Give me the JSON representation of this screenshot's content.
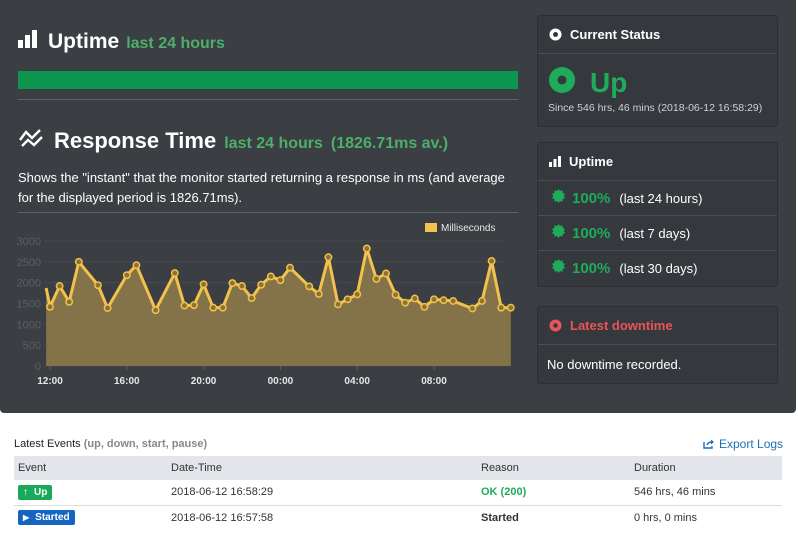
{
  "uptime_section": {
    "title": "Uptime",
    "subtitle": "last 24 hours",
    "bar_up_fraction": 1.0,
    "bar_color": "#0c9650"
  },
  "response_section": {
    "title": "Response Time",
    "subtitle": "last 24 hours",
    "average": "(1826.71ms av.)",
    "description": "Shows the \"instant\" that the monitor started returning a response in ms (and average for the displayed period is 1826.71ms)."
  },
  "chart_data": {
    "type": "area",
    "title": "",
    "legend": [
      "Milliseconds"
    ],
    "legend_position": "top-right",
    "xlabel": "",
    "ylabel": "",
    "ylim": [
      0,
      3000
    ],
    "yticks": [
      "0",
      "500",
      "1000",
      "1500",
      "2000",
      "2500",
      "3000"
    ],
    "xticks": [
      "12:00",
      "16:00",
      "20:00",
      "00:00",
      "04:00",
      "08:00"
    ],
    "x_hours": [
      -0.2,
      0.0,
      0.5,
      1.0,
      1.5,
      2.5,
      3.0,
      4.0,
      4.5,
      5.5,
      6.5,
      7.0,
      7.5,
      8.0,
      8.5,
      9.0,
      9.5,
      10.0,
      10.5,
      11.0,
      11.5,
      12.0,
      12.5,
      13.5,
      14.0,
      14.5,
      15.0,
      15.5,
      16.0,
      16.5,
      17.0,
      17.5,
      18.0,
      18.5,
      19.0,
      19.5,
      20.0,
      20.5,
      21.0,
      22.0,
      22.5,
      23.0,
      23.5,
      24.0
    ],
    "series": [
      {
        "name": "Milliseconds",
        "color": "#f2c14e",
        "values": [
          1870,
          1420,
          1920,
          1540,
          2500,
          1940,
          1390,
          2180,
          2420,
          1340,
          2230,
          1450,
          1460,
          1960,
          1400,
          1400,
          1990,
          1920,
          1630,
          1950,
          2150,
          2060,
          2360,
          1910,
          1730,
          2610,
          1480,
          1600,
          1720,
          2820,
          2090,
          2220,
          1710,
          1520,
          1620,
          1420,
          1600,
          1580,
          1560,
          1380,
          1560,
          2520,
          1400,
          1400
        ]
      }
    ]
  },
  "current_status": {
    "header": "Current Status",
    "status": "Up",
    "since": "Since 546 hrs, 46 mins (2018-06-12 16:58:29)",
    "color": "#1fac5a"
  },
  "uptime_panel": {
    "header": "Uptime",
    "rows": [
      {
        "percent": "100%",
        "label": "(last 24 hours)"
      },
      {
        "percent": "100%",
        "label": "(last 7 days)"
      },
      {
        "percent": "100%",
        "label": "(last 30 days)"
      }
    ]
  },
  "downtime_panel": {
    "header": "Latest downtime",
    "body": "No downtime recorded.",
    "color": "#e8545a"
  },
  "events": {
    "title": "Latest Events",
    "subtitle": "(up, down, start, pause)",
    "export_label": "Export Logs",
    "columns": [
      "Event",
      "Date-Time",
      "Reason",
      "Duration"
    ],
    "rows": [
      {
        "event": "Up",
        "datetime": "2018-06-12 16:58:29",
        "reason": "OK (200)",
        "duration": "546 hrs, 46 mins"
      },
      {
        "event": "Started",
        "datetime": "2018-06-12 16:57:58",
        "reason": "Started",
        "duration": "0 hrs, 0 mins"
      }
    ]
  }
}
